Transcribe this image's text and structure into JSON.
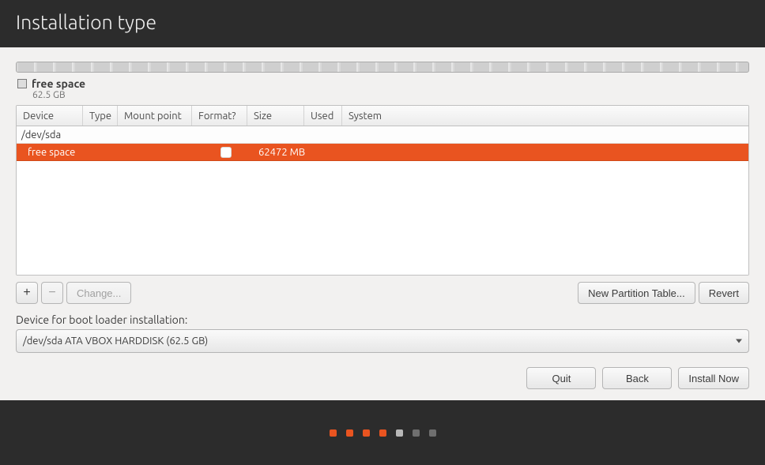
{
  "header": {
    "title": "Installation type"
  },
  "legend": {
    "title": "free space",
    "subtitle": "62.5 GB"
  },
  "columns": {
    "device": "Device",
    "type": "Type",
    "mount": "Mount point",
    "format": "Format?",
    "size": "Size",
    "used": "Used",
    "system": "System"
  },
  "rows": {
    "parent_device": "/dev/sda",
    "child_device": "free space",
    "child_size": "62472 MB"
  },
  "toolbar": {
    "add": "+",
    "remove": "−",
    "change": "Change...",
    "new_table": "New Partition Table...",
    "revert": "Revert"
  },
  "bootloader": {
    "label": "Device for boot loader installation:",
    "value": "/dev/sda  ATA VBOX HARDDISK (62.5 GB)"
  },
  "actions": {
    "quit": "Quit",
    "back": "Back",
    "install": "Install Now"
  },
  "progress": {
    "steps": [
      "orange",
      "orange",
      "orange",
      "orange",
      "grey",
      "dark",
      "dark"
    ]
  }
}
